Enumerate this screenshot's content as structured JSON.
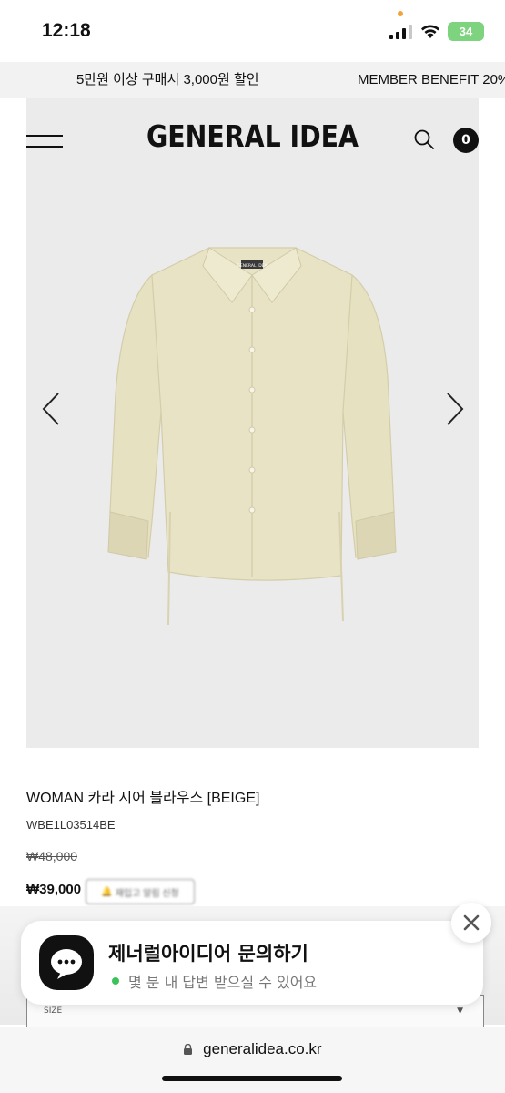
{
  "status_bar": {
    "time": "12:18",
    "battery": "34"
  },
  "promo": {
    "left_text": "5만원 이상 구매시 3,000원 할인",
    "right_text": "MEMBER BENEFIT 20%"
  },
  "header": {
    "brand": "GENERAL IDEA",
    "cart_count": "0"
  },
  "product": {
    "name": "WOMAN 카라 시어 블라우스 [BEIGE]",
    "code": "WBE1L03514BE",
    "price_original": "₩48,000",
    "price_sale": "₩39,000",
    "restock_label": "재입고 알림 신청",
    "shirt_color": "#e8e3c4",
    "shirt_label": "GENERAL IDEA"
  },
  "size_select": {
    "label": "SIZE"
  },
  "chat": {
    "title": "제너럴아이디어 문의하기",
    "status": "몇 분 내 답변 받으실 수 있어요"
  },
  "browser": {
    "url": "generalidea.co.kr"
  }
}
